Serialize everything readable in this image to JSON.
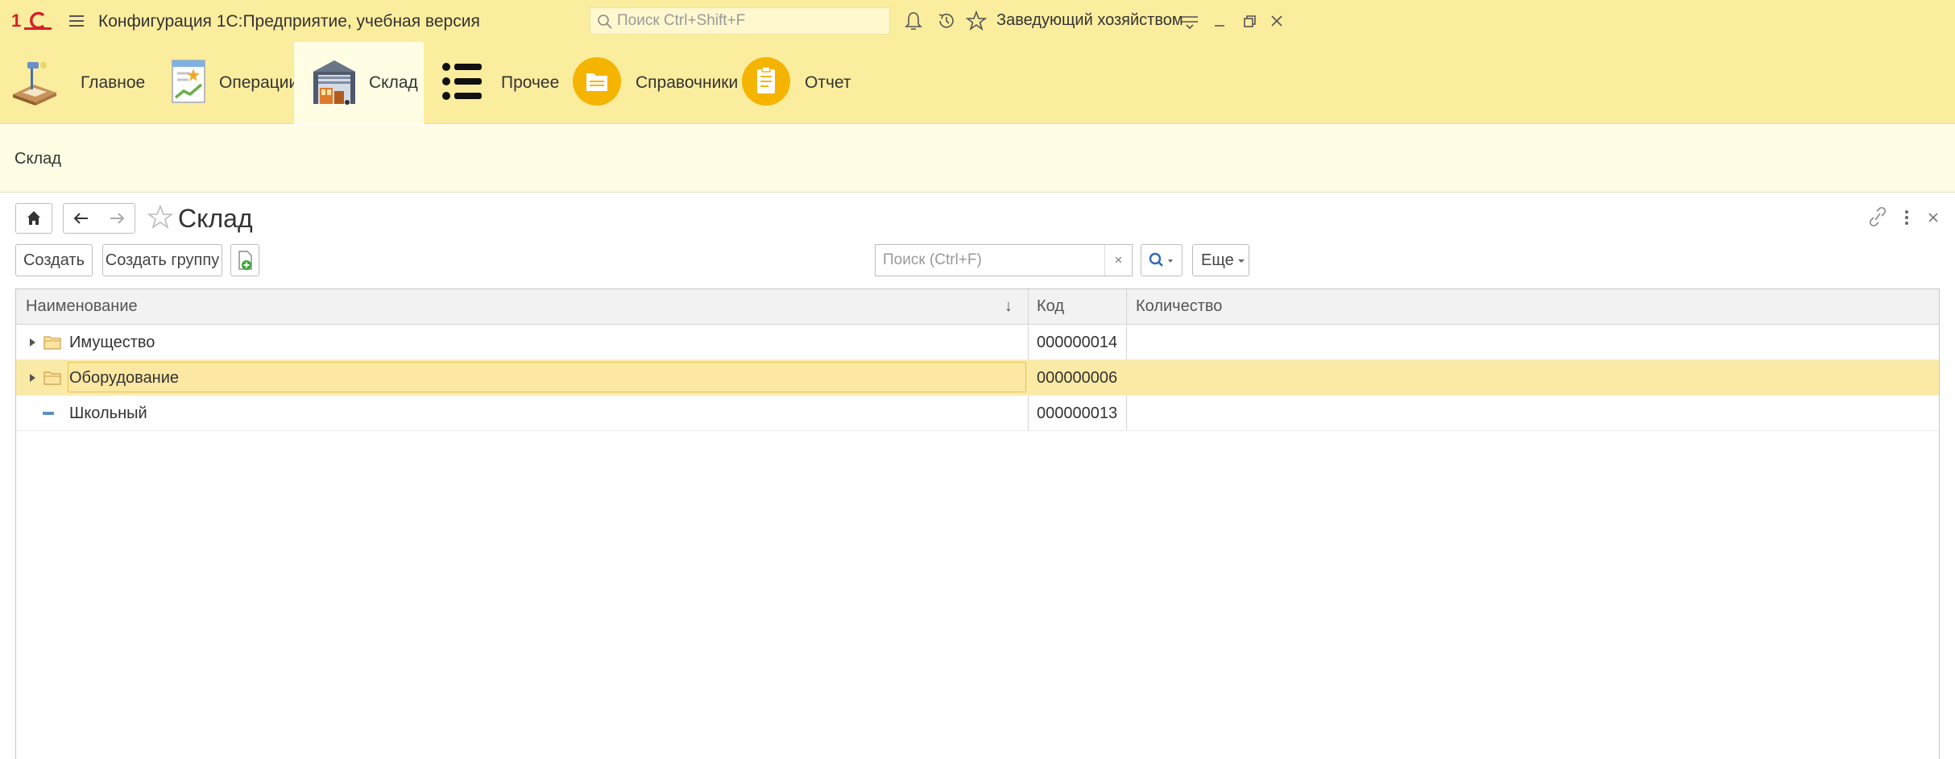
{
  "app": {
    "title": "Конфигурация 1С:Предприятие, учебная версия",
    "search_placeholder": "Поиск Ctrl+Shift+F",
    "user": "Заведующий хозяйством"
  },
  "sections": [
    {
      "label": "Главное",
      "icon": "desk-lamp-icon"
    },
    {
      "label": "Операции",
      "icon": "document-chart-icon"
    },
    {
      "label": "Склад",
      "icon": "warehouse-icon",
      "active": true
    },
    {
      "label": "Прочее",
      "icon": "list-icon"
    },
    {
      "label": "Справочники",
      "icon": "folder-circle-icon"
    },
    {
      "label": "Отчет",
      "icon": "clipboard-circle-icon"
    }
  ],
  "nav_strip": {
    "label": "Склад"
  },
  "form": {
    "title": "Склад",
    "toolbar": {
      "create": "Создать",
      "create_group": "Создать группу",
      "search_placeholder": "Поиск (Ctrl+F)",
      "more": "Еще"
    },
    "table": {
      "columns": [
        "Наименование",
        "Код",
        "Количество"
      ],
      "sort_indicator": "↓",
      "rows": [
        {
          "name": "Имущество",
          "code": "000000014",
          "quantity": "",
          "type": "group"
        },
        {
          "name": "Оборудование",
          "code": "000000006",
          "quantity": "",
          "type": "group",
          "selected": true
        },
        {
          "name": "Школьный",
          "code": "000000013",
          "quantity": "",
          "type": "item"
        }
      ]
    }
  },
  "colors": {
    "header_bg": "#fbed9e",
    "active_section_bg": "#fffde3",
    "selected_row_bg": "#fbeaa5",
    "accent_orange": "#f5b400",
    "search_icon_blue": "#2d6bb5"
  }
}
